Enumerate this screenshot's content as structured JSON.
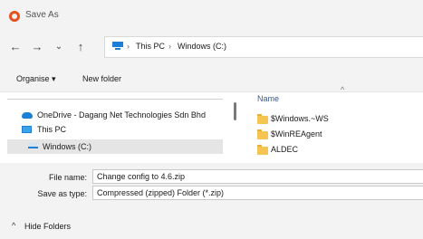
{
  "window": {
    "title": "Save As"
  },
  "nav": {
    "back": "←",
    "forward": "→",
    "recent": "⌄",
    "up": "↑"
  },
  "address": {
    "crumbs": [
      "This PC",
      "Windows (C:)"
    ],
    "separator": "›"
  },
  "commandbar": {
    "organise": "Organise ▾",
    "new_folder": "New folder"
  },
  "sidebar": {
    "items": [
      {
        "label": "OneDrive - Dagang Net Technologies Sdn Bhd",
        "icon": "cloud-icon"
      },
      {
        "label": "This PC",
        "icon": "computer-icon"
      },
      {
        "label": "Windows (C:)",
        "icon": "drive-icon",
        "selected": true
      }
    ]
  },
  "filelist": {
    "column_name": "Name",
    "sort_indicator": "^",
    "items": [
      "$Windows.~WS",
      "$WinREAgent",
      "ALDEC"
    ]
  },
  "form": {
    "filename_label": "File name:",
    "filename_value": "Change  config to 4.6.zip",
    "savetype_label": "Save as type:",
    "savetype_value": "Compressed (zipped) Folder (*.zip)"
  },
  "footer": {
    "hide_folders": "Hide Folders",
    "hide_icon": "^"
  },
  "colors": {
    "accent": "#1e7fd6",
    "folder": "#f6c451",
    "background": "#f3f3f3"
  }
}
